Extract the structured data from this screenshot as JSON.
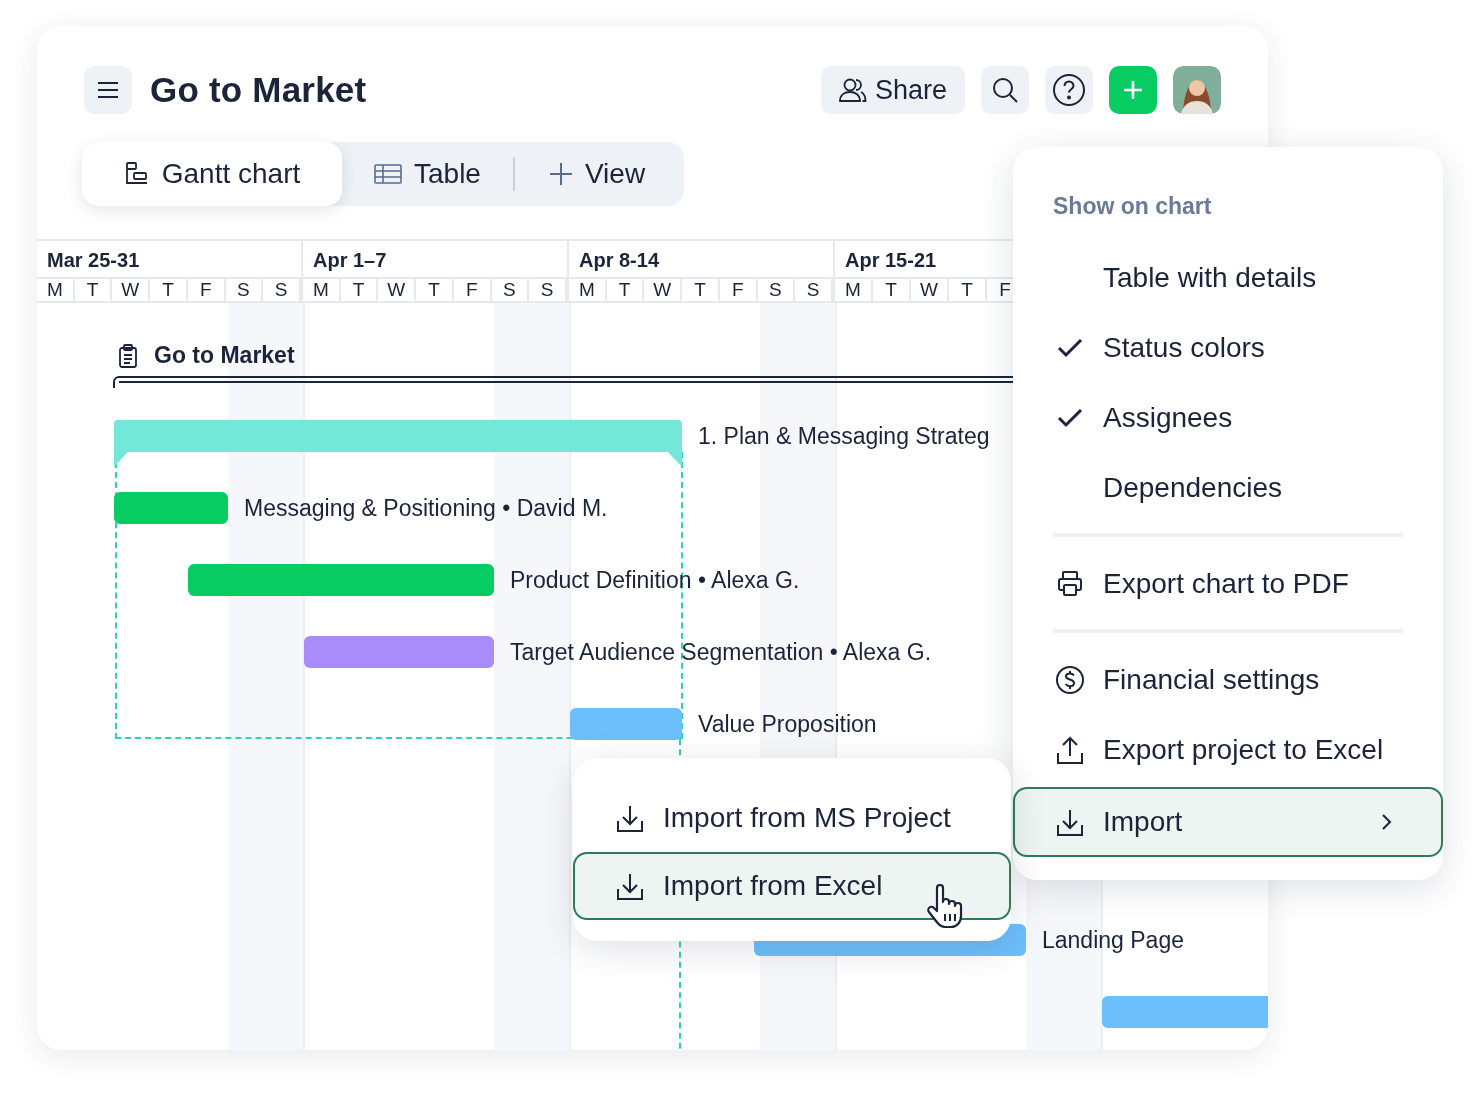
{
  "header": {
    "title": "Go to Market",
    "share_label": "Share"
  },
  "views": [
    {
      "label": "Gantt chart",
      "selected": true
    },
    {
      "label": "Table",
      "selected": false
    }
  ],
  "add_view": {
    "label": "View"
  },
  "timeline": {
    "weeks": [
      {
        "label": "Mar 25-31",
        "days": [
          "M",
          "T",
          "W",
          "T",
          "F",
          "S",
          "S"
        ]
      },
      {
        "label": "Apr 1–7",
        "days": [
          "M",
          "T",
          "W",
          "T",
          "F",
          "S",
          "S"
        ]
      },
      {
        "label": "Apr 8-14",
        "days": [
          "M",
          "T",
          "W",
          "T",
          "F",
          "S",
          "S"
        ]
      },
      {
        "label": "Apr 15-21",
        "days": [
          "M",
          "T",
          "W",
          "T",
          "F"
        ]
      }
    ]
  },
  "project": {
    "name": "Go to Market"
  },
  "tasks": [
    {
      "kind": "group",
      "label": "1. Plan & Messaging Strateg",
      "color": "#74e8d8"
    },
    {
      "kind": "task",
      "label": "Messaging & Positioning • David M.",
      "color": "#06cc62"
    },
    {
      "kind": "task",
      "label": "Product Definition • Alexa G.",
      "color": "#06cc62"
    },
    {
      "kind": "task",
      "label": "Target Audience Segmentation • Alexa G.",
      "color": "#a98bfa"
    },
    {
      "kind": "task",
      "label": "Value Proposition",
      "color": "#6dbffb"
    },
    {
      "kind": "task",
      "label": "Landing Page",
      "color": "#6dbffb"
    },
    {
      "kind": "task",
      "color": "#6dbffb"
    }
  ],
  "menu": {
    "heading": "Show on chart",
    "options": [
      {
        "label": "Table with details",
        "checked": false
      },
      {
        "label": "Status colors",
        "checked": true
      },
      {
        "label": "Assignees",
        "checked": true
      },
      {
        "label": "Dependencies",
        "checked": false
      }
    ],
    "actions": [
      {
        "label": "Export chart to PDF",
        "selected": false
      },
      {
        "label": "Financial settings",
        "selected": false
      },
      {
        "label": "Export project to Excel",
        "selected": false
      },
      {
        "label": "Import",
        "selected": true
      }
    ]
  },
  "submenu": {
    "items": [
      {
        "label": "Import from MS Project",
        "selected": false
      },
      {
        "label": "Import from Excel",
        "selected": true
      }
    ]
  }
}
